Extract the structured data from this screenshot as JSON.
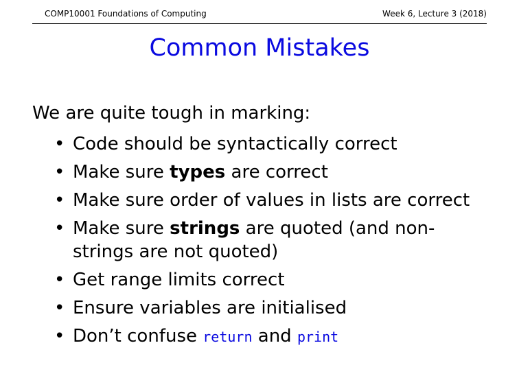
{
  "header": {
    "left": "COMP10001 Foundations of Computing",
    "right": "Week 6, Lecture 3 (2018)"
  },
  "slide": {
    "title": "Common Mistakes",
    "intro": "We are quite tough in marking:",
    "bullet": "•",
    "points": [
      {
        "text": "Code should be syntactically correct"
      },
      {
        "pre": "Make sure ",
        "bold": "types",
        "post": " are correct"
      },
      {
        "text": "Make sure order of values in lists are correct"
      },
      {
        "pre": "Make sure ",
        "bold": "strings",
        "post": " are quoted (and non-strings are not quoted)"
      },
      {
        "text": "Get range limits correct"
      },
      {
        "text": "Ensure variables are initialised"
      },
      {
        "pre": "Don’t confuse ",
        "code1": "return",
        "mid": " and ",
        "code2": "print"
      }
    ]
  },
  "colors": {
    "accent": "#0a0ae0",
    "text": "#000000"
  }
}
